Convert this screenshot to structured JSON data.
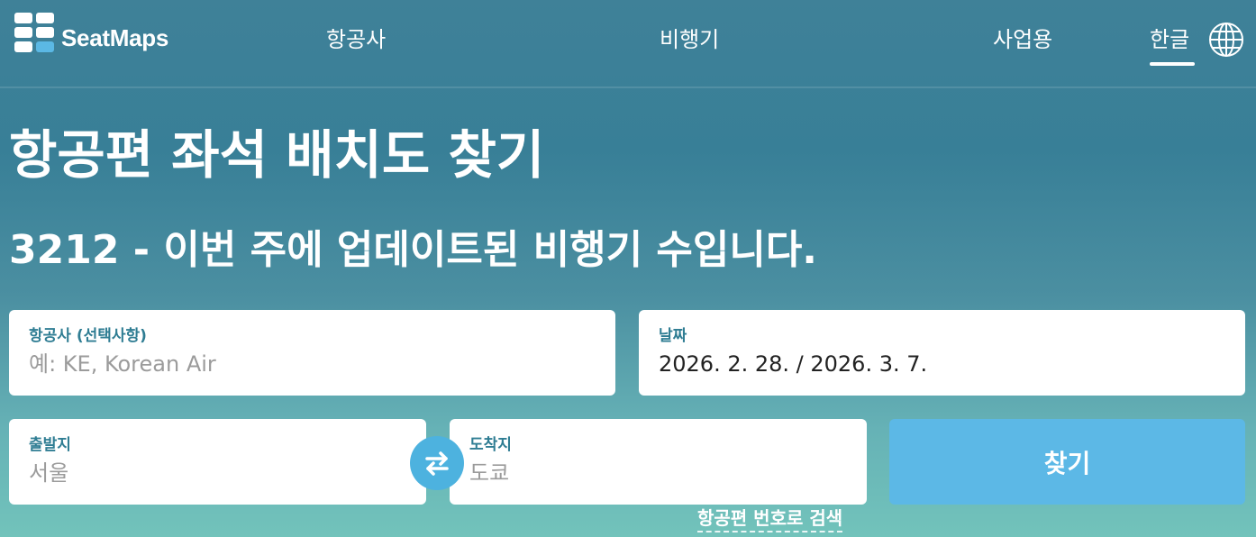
{
  "header": {
    "brand": "SeatMaps",
    "nav": {
      "airlines": "항공사",
      "aircraft": "비행기",
      "business": "사업용",
      "language": "한글"
    }
  },
  "hero": {
    "title": "항공편 좌석 배치도 찾기",
    "subtitle": "3212 - 이번 주에 업데이트된 비행기 수입니다."
  },
  "search": {
    "airline": {
      "label": "항공사 (선택사항)",
      "placeholder": "예: KE, Korean Air"
    },
    "date": {
      "label": "날짜",
      "value": "2026. 2. 28. / 2026. 3. 7."
    },
    "origin": {
      "label": "출발지",
      "placeholder": "서울"
    },
    "destination": {
      "label": "도착지",
      "placeholder": "도쿄"
    },
    "submit_label": "찾기",
    "flight_number_link": "항공편 번호로 검색"
  },
  "colors": {
    "accent": "#5cb8e6",
    "label": "#2f7d93"
  }
}
